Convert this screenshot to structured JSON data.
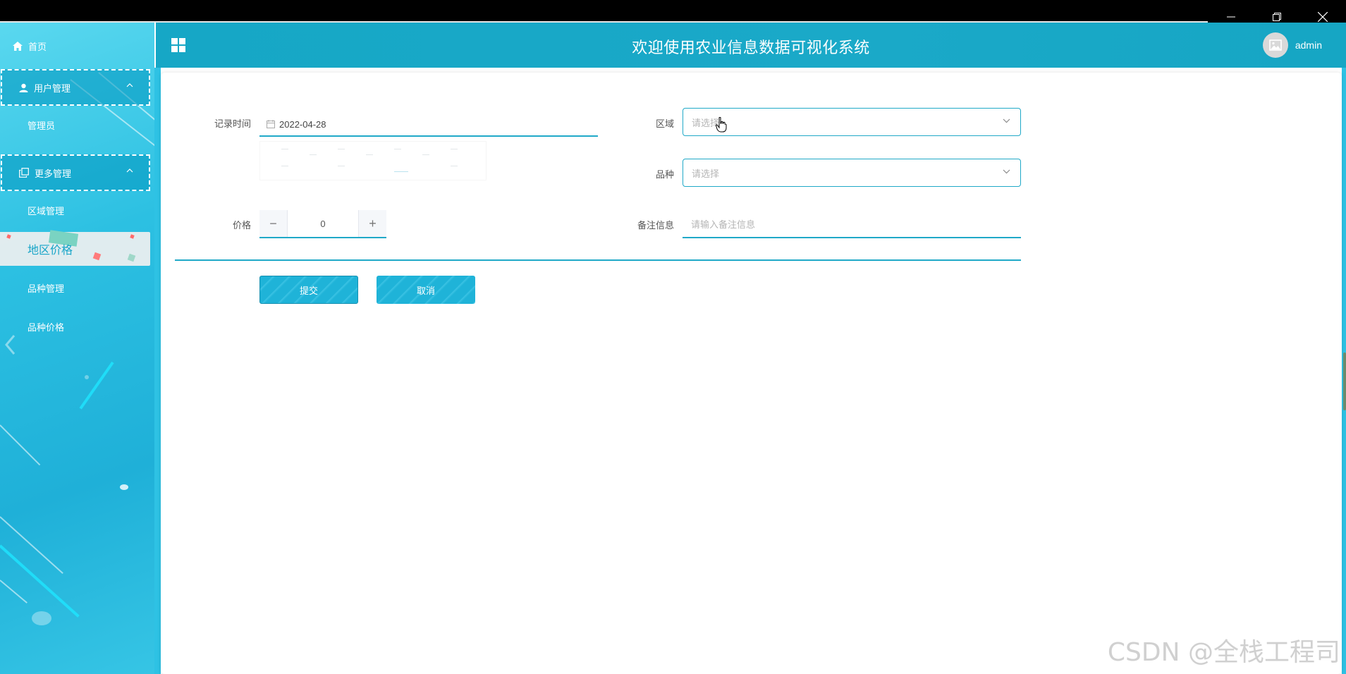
{
  "window": {
    "minimize_icon": "minimize-icon",
    "restore_icon": "restore-icon",
    "close_icon": "close-icon"
  },
  "header": {
    "title": "欢迎使用农业信息数据可视化系统",
    "user_name": "admin",
    "menu_icon": "grid-icon"
  },
  "sidebar": {
    "home_label": "首页",
    "groups": [
      {
        "label": "用户管理",
        "icon": "user-icon",
        "items": [
          "管理员"
        ]
      },
      {
        "label": "更多管理",
        "icon": "copy-icon",
        "items": [
          "区域管理",
          "地区价格",
          "品种管理",
          "品种价格"
        ]
      }
    ],
    "active_item": "地区价格"
  },
  "form": {
    "record_time_label": "记录时间",
    "record_time_value": "2022-04-28",
    "region_label": "区域",
    "region_placeholder": "请选择",
    "variety_label": "品种",
    "variety_placeholder": "请选择",
    "price_label": "价格",
    "price_value": "0",
    "price_minus": "−",
    "price_plus": "+",
    "note_label": "备注信息",
    "note_placeholder": "请输入备注信息",
    "submit_label": "提交",
    "cancel_label": "取消"
  },
  "watermark": "CSDN @全栈工程司"
}
